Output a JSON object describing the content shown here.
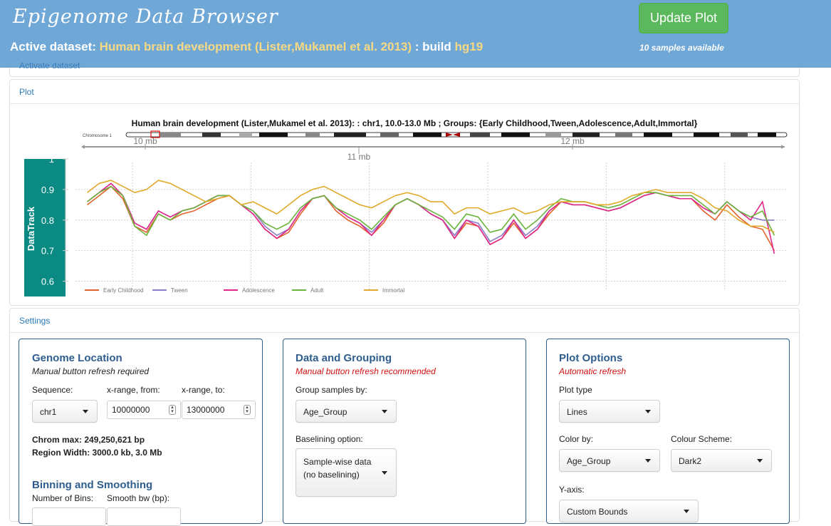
{
  "header": {
    "app_title": "Epigenome Data Browser",
    "active_prefix": "Active dataset:",
    "dataset": "Human brain development (Lister,Mukamel et al. 2013)",
    "build_prefix": ": build",
    "build": "hg19",
    "update_button": "Update Plot",
    "samples_note": "10 samples available",
    "activate_link": "Activate dataset"
  },
  "plot_panel": {
    "heading": "Plot",
    "title": "Human brain development (Lister,Mukamel et al. 2013): : chr1, 10.0-13.0 Mb ; Groups: {Early Childhood,Tween,Adolescence,Adult,Immortal}",
    "ideogram_label": "Chromosome 1",
    "axis_ticks": [
      "10 mb",
      "11 mb",
      "12 mb"
    ],
    "track_label": "DataTrack",
    "y_ticks": [
      "1",
      "0.9",
      "0.8",
      "0.7",
      "0.6"
    ]
  },
  "chart_data": {
    "type": "line",
    "title": "Human brain development (Lister,Mukamel et al. 2013): : chr1, 10.0-13.0 Mb ; Groups: {Early Childhood,Tween,Adolescence,Adult,Immortal}",
    "xlabel": "",
    "ylabel": "DataTrack",
    "xlim": [
      10.0,
      13.0
    ],
    "ylim": [
      0.55,
      1.0
    ],
    "x_ticks": [
      "10 mb",
      "11 mb",
      "12 mb"
    ],
    "y_ticks": [
      1,
      0.9,
      0.8,
      0.7,
      0.6
    ],
    "grid": true,
    "legend": "bottom",
    "x": [
      10.05,
      10.1,
      10.15,
      10.2,
      10.25,
      10.3,
      10.35,
      10.4,
      10.45,
      10.5,
      10.55,
      10.6,
      10.65,
      10.7,
      10.75,
      10.8,
      10.85,
      10.9,
      10.95,
      11.0,
      11.05,
      11.1,
      11.15,
      11.2,
      11.25,
      11.3,
      11.35,
      11.4,
      11.45,
      11.5,
      11.55,
      11.6,
      11.65,
      11.7,
      11.75,
      11.8,
      11.85,
      11.9,
      11.95,
      12.0,
      12.05,
      12.1,
      12.15,
      12.2,
      12.25,
      12.3,
      12.35,
      12.4,
      12.45,
      12.5,
      12.55,
      12.6,
      12.65,
      12.7,
      12.75,
      12.8,
      12.85,
      12.9,
      12.95
    ],
    "series": [
      {
        "name": "Early Childhood",
        "color": "#e2622b",
        "values": [
          0.85,
          0.88,
          0.91,
          0.87,
          0.78,
          0.76,
          0.82,
          0.8,
          0.82,
          0.83,
          0.85,
          0.87,
          0.88,
          0.85,
          0.82,
          0.77,
          0.74,
          0.76,
          0.82,
          0.87,
          0.88,
          0.83,
          0.8,
          0.78,
          0.75,
          0.79,
          0.85,
          0.87,
          0.85,
          0.82,
          0.8,
          0.74,
          0.79,
          0.78,
          0.72,
          0.74,
          0.79,
          0.74,
          0.77,
          0.82,
          0.86,
          0.85,
          0.85,
          0.84,
          0.83,
          0.84,
          0.86,
          0.88,
          0.89,
          0.88,
          0.87,
          0.87,
          0.83,
          0.8,
          0.85,
          0.81,
          0.78,
          0.77,
          0.7
        ]
      },
      {
        "name": "Tween",
        "color": "#8a7cc8",
        "values": [
          0.86,
          0.89,
          0.92,
          0.88,
          0.79,
          0.77,
          0.83,
          0.81,
          0.83,
          0.84,
          0.86,
          0.88,
          0.88,
          0.85,
          0.83,
          0.78,
          0.75,
          0.77,
          0.83,
          0.87,
          0.88,
          0.84,
          0.81,
          0.79,
          0.76,
          0.8,
          0.85,
          0.87,
          0.85,
          0.82,
          0.8,
          0.75,
          0.8,
          0.79,
          0.73,
          0.75,
          0.8,
          0.75,
          0.78,
          0.83,
          0.86,
          0.85,
          0.85,
          0.84,
          0.83,
          0.84,
          0.86,
          0.88,
          0.89,
          0.88,
          0.87,
          0.87,
          0.84,
          0.82,
          0.86,
          0.83,
          0.81,
          0.8,
          0.8
        ]
      },
      {
        "name": "Adolescence",
        "color": "#e0288a",
        "values": [
          0.86,
          0.89,
          0.92,
          0.88,
          0.79,
          0.77,
          0.83,
          0.81,
          0.83,
          0.84,
          0.86,
          0.88,
          0.88,
          0.85,
          0.82,
          0.77,
          0.74,
          0.77,
          0.83,
          0.87,
          0.88,
          0.84,
          0.81,
          0.79,
          0.75,
          0.8,
          0.85,
          0.87,
          0.85,
          0.82,
          0.8,
          0.74,
          0.8,
          0.78,
          0.72,
          0.74,
          0.8,
          0.74,
          0.77,
          0.83,
          0.86,
          0.85,
          0.85,
          0.84,
          0.83,
          0.84,
          0.86,
          0.88,
          0.89,
          0.88,
          0.87,
          0.87,
          0.84,
          0.82,
          0.86,
          0.83,
          0.8,
          0.86,
          0.69
        ]
      },
      {
        "name": "Adult",
        "color": "#6ab43c",
        "values": [
          0.86,
          0.89,
          0.91,
          0.88,
          0.78,
          0.75,
          0.82,
          0.8,
          0.83,
          0.84,
          0.86,
          0.88,
          0.88,
          0.85,
          0.83,
          0.79,
          0.77,
          0.79,
          0.84,
          0.87,
          0.88,
          0.84,
          0.82,
          0.8,
          0.77,
          0.81,
          0.85,
          0.87,
          0.85,
          0.83,
          0.81,
          0.77,
          0.82,
          0.81,
          0.76,
          0.77,
          0.82,
          0.77,
          0.8,
          0.84,
          0.87,
          0.86,
          0.86,
          0.85,
          0.84,
          0.85,
          0.87,
          0.89,
          0.89,
          0.88,
          0.88,
          0.88,
          0.85,
          0.82,
          0.86,
          0.83,
          0.81,
          0.83,
          0.75
        ]
      },
      {
        "name": "Immortal",
        "color": "#e1a92a",
        "values": [
          0.89,
          0.92,
          0.93,
          0.91,
          0.89,
          0.9,
          0.93,
          0.92,
          0.9,
          0.88,
          0.86,
          0.87,
          0.88,
          0.85,
          0.86,
          0.84,
          0.82,
          0.85,
          0.88,
          0.9,
          0.91,
          0.89,
          0.87,
          0.85,
          0.84,
          0.86,
          0.88,
          0.89,
          0.88,
          0.86,
          0.86,
          0.82,
          0.84,
          0.84,
          0.82,
          0.83,
          0.84,
          0.82,
          0.83,
          0.85,
          0.86,
          0.86,
          0.86,
          0.85,
          0.85,
          0.86,
          0.88,
          0.89,
          0.9,
          0.89,
          0.89,
          0.89,
          0.87,
          0.84,
          0.83,
          0.8,
          0.78,
          0.78,
          0.76
        ]
      }
    ]
  },
  "settings_panel": {
    "heading": "Settings",
    "genome": {
      "title": "Genome Location",
      "subtitle": "Manual button refresh required",
      "sequence_label": "Sequence:",
      "sequence_value": "chr1",
      "from_label": "x-range, from:",
      "from_value": "10000000",
      "to_label": "x-range, to:",
      "to_value": "13000000",
      "chrom_max": "Chrom max: 249,250,621 bp",
      "region_width": "Region Width: 3000.0 kb, 3.0 Mb",
      "binning_title": "Binning and Smoothing",
      "bins_label": "Number of Bins:",
      "smooth_label": "Smooth bw (bp):"
    },
    "data_grouping": {
      "title": "Data and Grouping",
      "subtitle": "Manual button refresh recommended",
      "group_label": "Group samples by:",
      "group_value": "Age_Group",
      "baseline_label": "Baselining option:",
      "baseline_line1": "Sample-wise data",
      "baseline_line2": "(no baselining)"
    },
    "plot_options": {
      "title": "Plot Options",
      "subtitle": "Automatic refresh",
      "plot_type_label": "Plot type",
      "plot_type_value": "Lines",
      "color_by_label": "Color by:",
      "color_by_value": "Age_Group",
      "scheme_label": "Colour Scheme:",
      "scheme_value": "Dark2",
      "yaxis_label": "Y-axis:",
      "yaxis_value": "Custom Bounds"
    }
  }
}
